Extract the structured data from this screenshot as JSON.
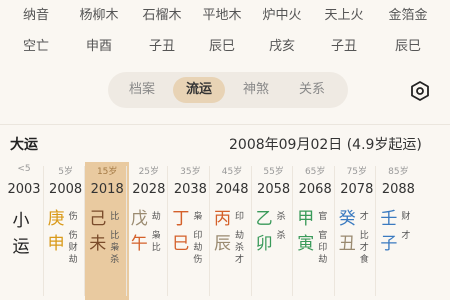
{
  "nayin": {
    "label": "纳音",
    "values": [
      "杨柳木",
      "石榴木",
      "平地木",
      "炉中火",
      "天上火",
      "金箔金"
    ]
  },
  "kongwang": {
    "label": "空亡",
    "values": [
      "申酉",
      "子丑",
      "辰巳",
      "戌亥",
      "子丑",
      "辰巳"
    ]
  },
  "tabs": [
    "档案",
    "流运",
    "神煞",
    "关系"
  ],
  "active_tab": "流运",
  "dayun": {
    "title": "大运",
    "start_info": "2008年09月02日 (4.9岁起运)",
    "xiaoyun": [
      "小",
      "运"
    ],
    "columns": [
      {
        "age": "<5",
        "year": "2003"
      },
      {
        "age": "5岁",
        "year": "2008",
        "gan": "庚",
        "zhi": "申",
        "gan_shen": "伤",
        "zhi_shen": "伤财劫",
        "gan_color": "#d99a1a",
        "zhi_color": "#d99a1a"
      },
      {
        "age": "15岁",
        "year": "2018",
        "gan": "己",
        "zhi": "未",
        "gan_shen": "比",
        "zhi_shen": "比枭杀",
        "gan_color": "#7a4b2a",
        "zhi_color": "#7a4b2a",
        "highlight": true
      },
      {
        "age": "25岁",
        "year": "2028",
        "gan": "戊",
        "zhi": "午",
        "gan_shen": "劫",
        "zhi_shen": "枭比",
        "gan_color": "#9a8a70",
        "zhi_color": "#d4602a"
      },
      {
        "age": "35岁",
        "year": "2038",
        "gan": "丁",
        "zhi": "巳",
        "gan_shen": "枭",
        "zhi_shen": "印劫伤",
        "gan_color": "#d4602a",
        "zhi_color": "#d4602a"
      },
      {
        "age": "45岁",
        "year": "2048",
        "gan": "丙",
        "zhi": "辰",
        "gan_shen": "印",
        "zhi_shen": "劫杀才",
        "gan_color": "#d4602a",
        "zhi_color": "#9a8a70"
      },
      {
        "age": "55岁",
        "year": "2058",
        "gan": "乙",
        "zhi": "卯",
        "gan_shen": "杀",
        "zhi_shen": "杀",
        "gan_color": "#3a9a5a",
        "zhi_color": "#3a9a5a"
      },
      {
        "age": "65岁",
        "year": "2068",
        "gan": "甲",
        "zhi": "寅",
        "gan_shen": "官",
        "zhi_shen": "官印劫",
        "gan_color": "#3a9a5a",
        "zhi_color": "#3a9a5a"
      },
      {
        "age": "75岁",
        "year": "2078",
        "gan": "癸",
        "zhi": "丑",
        "gan_shen": "才",
        "zhi_shen": "比才食",
        "gan_color": "#3a7ac0",
        "zhi_color": "#9a8a70"
      },
      {
        "age": "85岁",
        "year": "2088",
        "gan": "壬",
        "zhi": "子",
        "gan_shen": "财",
        "zhi_shen": "才",
        "gan_color": "#3a7ac0",
        "zhi_color": "#3a7ac0"
      }
    ]
  },
  "icons": {
    "settings": "settings-hexagon-icon"
  }
}
